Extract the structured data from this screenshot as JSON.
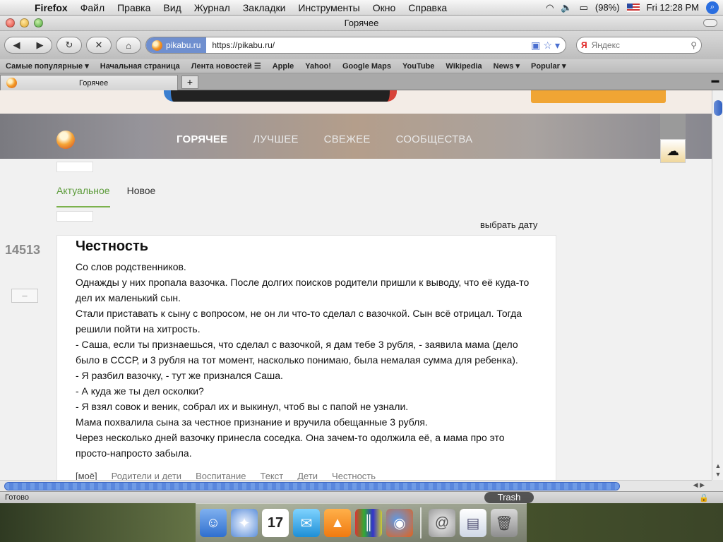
{
  "menubar": {
    "app": "Firefox",
    "items": [
      "Файл",
      "Правка",
      "Вид",
      "Журнал",
      "Закладки",
      "Инструменты",
      "Окно",
      "Справка"
    ],
    "battery": "(98%)",
    "clock": "Fri 12:28 PM"
  },
  "window": {
    "title": "Горячее"
  },
  "navbar": {
    "site_identity": "pikabu.ru",
    "url": "https://pikabu.ru/",
    "search_placeholder": "Яндекс",
    "search_engine_letter": "Я"
  },
  "bookmarks": [
    "Самые популярные ▾",
    "Начальная страница",
    "Лента новостей ☰",
    "Apple",
    "Yahoo!",
    "Google Maps",
    "YouTube",
    "Wikipedia",
    "News ▾",
    "Popular ▾"
  ],
  "tab": {
    "label": "Горячее",
    "new_tab": "+"
  },
  "site": {
    "nav": [
      "ГОРЯЧЕЕ",
      "ЛУЧШЕЕ",
      "СВЕЖЕЕ",
      "СООБЩЕСТВА"
    ],
    "subtabs": [
      "Актуальное",
      "Новое"
    ],
    "pick_date": "выбрать дату"
  },
  "post": {
    "rating": "14513",
    "minus": "–",
    "title": "Честность",
    "paragraphs": [
      "Со слов родственников.",
      "Однажды у них пропала вазочка. После долгих поисков родители пришли к выводу, что её куда-то дел их маленький сын.",
      "Стали приставать к сыну с вопросом, не он ли что-то сделал с вазочкой. Сын всё отрицал. Тогда решили пойти на хитрость.",
      "- Саша, если ты признаешься, что сделал с вазочкой, я дам тебе 3 рубля, - заявила мама (дело было в СССР, и 3 рубля на тот момент, насколько понимаю, была немалая сумма для ребенка).",
      "- Я разбил вазочку, - тут же признался Саша.",
      "- А куда же ты дел осколки?",
      "- Я взял совок и веник, собрал их и выкинул, чтоб вы с папой не узнали.",
      "Мама похвалила сына за честное признание и вручила обещанные 3 рубля.",
      "Через несколько дней вазочку принесла соседка. Она зачем-то одолжила её, а мама про это просто-напросто забыла."
    ],
    "tags": [
      "[моё]",
      "Родители и дети",
      "Воспитание",
      "Текст",
      "Дети",
      "Честность"
    ]
  },
  "status": {
    "text": "Готово"
  },
  "dock": {
    "trash_label": "Trash",
    "calendar_day": "17"
  }
}
